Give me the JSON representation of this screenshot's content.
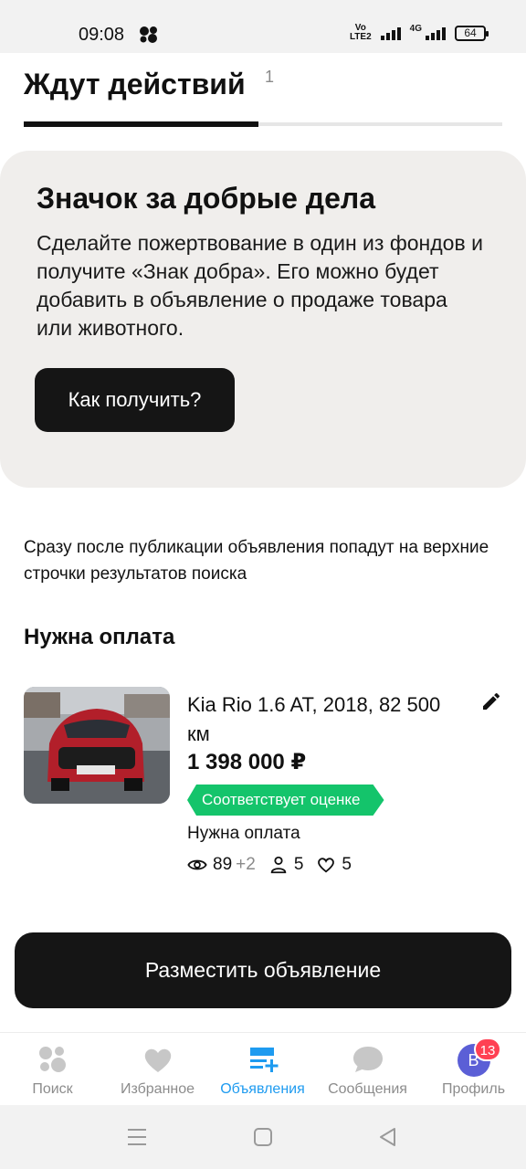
{
  "status_bar": {
    "time": "09:08",
    "network": "4G",
    "battery": "64",
    "volte": "Vo\nLTE2"
  },
  "tabs": {
    "active_label": "Ждут действий",
    "active_count": "1"
  },
  "promo": {
    "title": "Значок за добрые дела",
    "text": "Сделайте пожертвование в один из фондов и получите «Знак добра». Его можно будет добавить в объявление о продаже товара или животного.",
    "button_label": "Как получить?"
  },
  "info_text": "Сразу после публикации объявления попадут на верхние строчки результатов поиска",
  "section_title": "Нужна оплата",
  "listing": {
    "title": "Kia Rio 1.6 AT, 2018, 82 500 км",
    "price": "1 398 000 ₽",
    "badge": "Соответствует оценке",
    "status": "Нужна оплата",
    "views": "89",
    "views_new": "+2",
    "contacts": "5",
    "favorites": "5",
    "icons": [
      "eye-icon",
      "person-icon",
      "heart-icon",
      "pencil-icon"
    ]
  },
  "publish_button": "Разместить объявление",
  "bottom_nav": {
    "items": [
      {
        "label": "Поиск",
        "icon": "search-dots-icon"
      },
      {
        "label": "Избранное",
        "icon": "heart-icon"
      },
      {
        "label": "Объявления",
        "icon": "listings-add-icon",
        "active": true
      },
      {
        "label": "Сообщения",
        "icon": "chat-bubble-icon"
      },
      {
        "label": "Профиль",
        "icon": "avatar"
      }
    ],
    "avatar_letter": "В",
    "profile_badge": "13"
  },
  "colors": {
    "accent": "#1e9bf0",
    "badge_green": "#14c46b",
    "dark": "#151515",
    "card_bg": "#f0eeec",
    "notification": "#ff4053"
  }
}
